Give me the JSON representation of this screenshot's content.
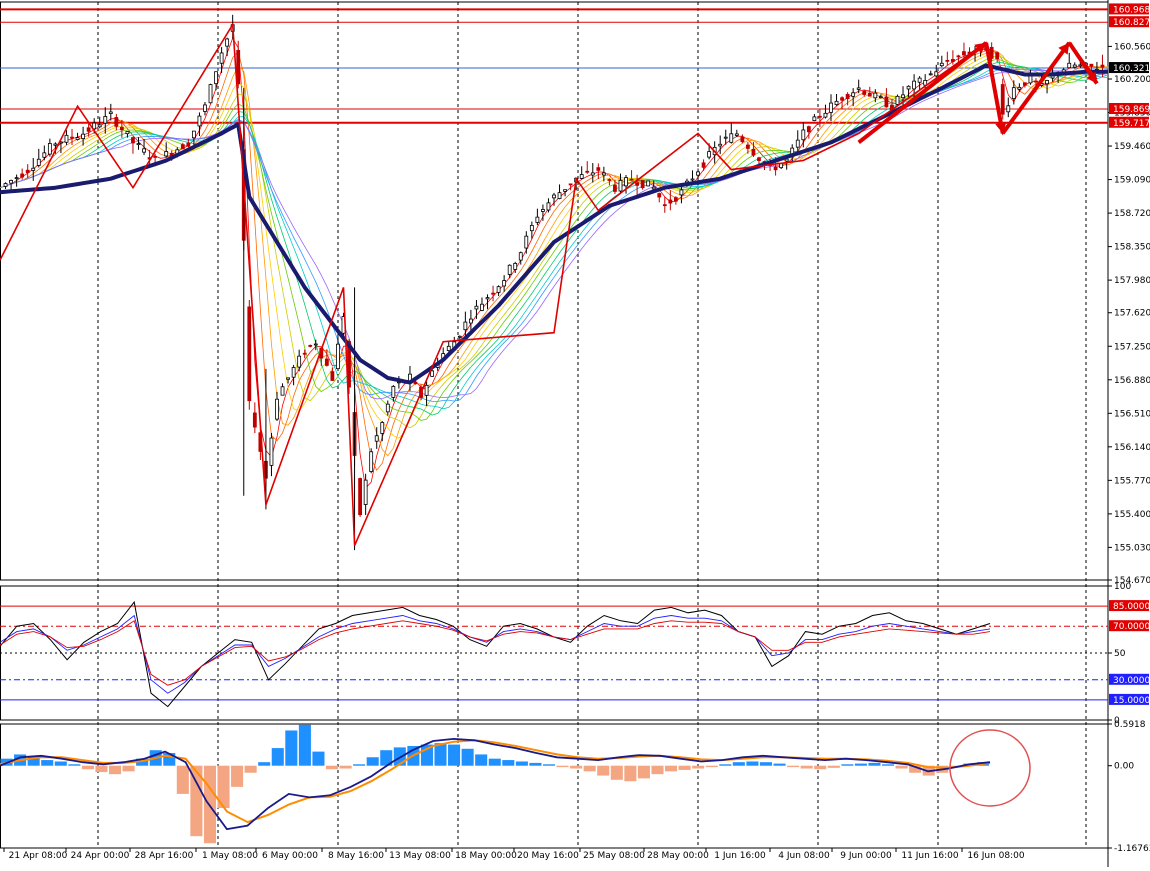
{
  "colors": {
    "background": "#ffffff",
    "bull": "#000000",
    "bear": "#c00000",
    "zigzag": "#e00000",
    "baseline_ma": "#1a1a6e",
    "level_red": "#e00000",
    "current_line": "#3366cc",
    "rsi_black": "#000000",
    "rsi_blue": "#1f1fff",
    "rsi_red": "#e00000",
    "macd_pos": "#1e90ff",
    "macd_neg": "#f4a582",
    "macd_line": "#1a1a8a",
    "signal_line": "#ff8c00",
    "ribbon": [
      "#ff0000",
      "#ff6600",
      "#ff9900",
      "#ffcc00",
      "#cccc00",
      "#66cc00",
      "#00cc66",
      "#00cccc",
      "#3399ff",
      "#9966ff"
    ]
  },
  "chart_data": [
    {
      "type": "candlestick",
      "title": "",
      "ylim": [
        154.67,
        161.05
      ],
      "y_ticks": [
        "160.560",
        "160.200",
        "159.830",
        "159.460",
        "159.090",
        "158.720",
        "158.350",
        "157.980",
        "157.620",
        "157.250",
        "156.880",
        "156.510",
        "156.140",
        "155.770",
        "155.400",
        "155.030",
        "154.670"
      ],
      "x_ticks": [
        "21 Apr 08:00",
        "24 Apr 00:00",
        "28 Apr 16:00",
        "1 May 08:00",
        "6 May 00:00",
        "8 May 16:00",
        "13 May 08:00",
        "18 May 00:00",
        "20 May 16:00",
        "25 May 08:00",
        "28 May 00:00",
        "1 Jun 16:00",
        "4 Jun 08:00",
        "9 Jun 00:00",
        "11 Jun 16:00",
        "16 Jun 08:00"
      ],
      "levels": [
        {
          "label": "160.968",
          "value": 160.968
        },
        {
          "label": "160.827",
          "value": 160.827
        },
        {
          "label": "159.869",
          "value": 159.869
        },
        {
          "label": "159.717",
          "value": 159.717
        }
      ],
      "current_price": {
        "label": "160.321",
        "value": 160.321
      },
      "close_path": [
        [
          0,
          159.0
        ],
        [
          5,
          159.2
        ],
        [
          10,
          159.5
        ],
        [
          15,
          159.6
        ],
        [
          20,
          159.8
        ],
        [
          24,
          159.5
        ],
        [
          28,
          159.3
        ],
        [
          31,
          159.4
        ],
        [
          34,
          159.5
        ],
        [
          37,
          159.9
        ],
        [
          40,
          160.5
        ],
        [
          42,
          160.8
        ],
        [
          43,
          160.1
        ],
        [
          44,
          158.4
        ],
        [
          45,
          156.6
        ],
        [
          46,
          156.4
        ],
        [
          48,
          155.8
        ],
        [
          50,
          156.7
        ],
        [
          52,
          156.9
        ],
        [
          55,
          157.2
        ],
        [
          57,
          157.3
        ],
        [
          60,
          156.9
        ],
        [
          62,
          157.6
        ],
        [
          64,
          156.0
        ],
        [
          65,
          155.4
        ],
        [
          67,
          156.1
        ],
        [
          69,
          156.4
        ],
        [
          71,
          156.8
        ],
        [
          74,
          156.9
        ],
        [
          76,
          156.7
        ],
        [
          79,
          157.1
        ],
        [
          82,
          157.3
        ],
        [
          85,
          157.6
        ],
        [
          88,
          157.8
        ],
        [
          91,
          158.0
        ],
        [
          94,
          158.3
        ],
        [
          97,
          158.7
        ],
        [
          100,
          158.9
        ],
        [
          104,
          159.1
        ],
        [
          108,
          159.2
        ],
        [
          111,
          159.0
        ],
        [
          114,
          159.1
        ],
        [
          118,
          159.0
        ],
        [
          120,
          158.8
        ],
        [
          123,
          158.95
        ],
        [
          126,
          159.2
        ],
        [
          130,
          159.5
        ],
        [
          133,
          159.6
        ],
        [
          136,
          159.4
        ],
        [
          139,
          159.2
        ],
        [
          142,
          159.3
        ],
        [
          145,
          159.6
        ],
        [
          148,
          159.8
        ],
        [
          152,
          160.0
        ],
        [
          155,
          160.1
        ],
        [
          158,
          160.0
        ],
        [
          161,
          159.9
        ],
        [
          164,
          160.1
        ],
        [
          167,
          160.2
        ],
        [
          171,
          160.4
        ],
        [
          175,
          160.5
        ],
        [
          178,
          160.55
        ],
        [
          180,
          160.4
        ],
        [
          181,
          159.8
        ],
        [
          183,
          160.1
        ],
        [
          186,
          160.2
        ],
        [
          188,
          160.1
        ],
        [
          191,
          160.3
        ],
        [
          194,
          160.35
        ],
        [
          196,
          160.33
        ]
      ],
      "baseline_path": [
        [
          0,
          158.95
        ],
        [
          10,
          159.0
        ],
        [
          20,
          159.1
        ],
        [
          30,
          159.3
        ],
        [
          40,
          159.6
        ],
        [
          43,
          159.7
        ],
        [
          45,
          158.9
        ],
        [
          50,
          158.4
        ],
        [
          55,
          157.9
        ],
        [
          60,
          157.5
        ],
        [
          65,
          157.1
        ],
        [
          70,
          156.9
        ],
        [
          74,
          156.85
        ],
        [
          80,
          157.1
        ],
        [
          90,
          157.7
        ],
        [
          100,
          158.4
        ],
        [
          110,
          158.8
        ],
        [
          120,
          159.0
        ],
        [
          130,
          159.1
        ],
        [
          140,
          159.3
        ],
        [
          150,
          159.5
        ],
        [
          160,
          159.8
        ],
        [
          170,
          160.1
        ],
        [
          178,
          160.35
        ],
        [
          185,
          160.25
        ],
        [
          190,
          160.25
        ],
        [
          196,
          160.28
        ]
      ],
      "zigzag": [
        [
          0,
          158.2
        ],
        [
          14,
          159.9
        ],
        [
          24,
          159.0
        ],
        [
          42,
          160.8
        ],
        [
          48,
          155.5
        ],
        [
          62,
          157.9
        ],
        [
          64,
          155.05
        ],
        [
          80,
          157.3
        ],
        [
          100,
          157.4
        ],
        [
          104,
          159.1
        ],
        [
          108,
          158.75
        ],
        [
          126,
          159.6
        ],
        [
          132,
          159.2
        ],
        [
          145,
          159.3
        ],
        [
          155,
          159.6
        ],
        [
          178,
          160.6
        ],
        [
          181,
          159.6
        ],
        [
          193,
          160.6
        ],
        [
          198,
          160.2
        ]
      ],
      "arrows": [
        {
          "from": [
            155,
            159.5
          ],
          "to": [
            178,
            160.6
          ]
        },
        {
          "from": [
            178,
            160.6
          ],
          "to": [
            181,
            159.6
          ]
        },
        {
          "from": [
            181,
            159.6
          ],
          "to": [
            193,
            160.6
          ]
        },
        {
          "from": [
            193,
            160.6
          ],
          "to": [
            198,
            160.15
          ]
        }
      ],
      "n_bars": 200
    },
    {
      "type": "line",
      "title": "",
      "ylim": [
        0,
        100
      ],
      "y_ticks": [
        "100",
        "50",
        "0"
      ],
      "levels": [
        {
          "label": "85.0000",
          "value": 85
        },
        {
          "label": "70.0000",
          "value": 70
        },
        {
          "label": "30.0000",
          "value": 30
        },
        {
          "label": "15.0000",
          "value": 15
        }
      ],
      "series": [
        {
          "values": [
            55,
            70,
            72,
            60,
            45,
            58,
            66,
            72,
            88,
            20,
            10,
            25,
            40,
            50,
            60,
            58,
            30,
            42,
            55,
            68,
            72,
            78,
            80,
            82,
            84,
            78,
            75,
            70,
            60,
            55,
            70,
            72,
            68,
            62,
            58,
            70,
            78,
            74,
            72,
            82,
            84,
            80,
            82,
            78,
            66,
            62,
            40,
            48,
            66,
            64,
            70,
            72,
            78,
            80,
            74,
            72,
            68,
            64,
            68,
            72
          ]
        },
        {
          "values": [
            58,
            66,
            68,
            62,
            52,
            56,
            62,
            68,
            78,
            30,
            20,
            28,
            40,
            48,
            56,
            56,
            40,
            46,
            54,
            62,
            68,
            72,
            74,
            76,
            78,
            74,
            72,
            68,
            62,
            58,
            66,
            68,
            66,
            62,
            60,
            66,
            72,
            70,
            70,
            76,
            78,
            76,
            76,
            74,
            66,
            62,
            48,
            50,
            60,
            60,
            64,
            66,
            70,
            72,
            70,
            68,
            66,
            64,
            66,
            68
          ]
        },
        {
          "values": [
            56,
            64,
            66,
            62,
            54,
            55,
            60,
            66,
            74,
            34,
            26,
            30,
            40,
            47,
            54,
            55,
            44,
            47,
            53,
            60,
            65,
            68,
            70,
            72,
            74,
            72,
            70,
            67,
            62,
            59,
            64,
            66,
            65,
            62,
            60,
            64,
            68,
            68,
            68,
            72,
            74,
            73,
            73,
            72,
            66,
            62,
            52,
            52,
            58,
            58,
            62,
            64,
            66,
            68,
            67,
            66,
            65,
            64,
            64,
            66
          ]
        }
      ]
    },
    {
      "type": "bar",
      "title": "",
      "ylim": [
        -1.16763,
        0.5918
      ],
      "y_ticks": [
        "0.5918",
        "0.00",
        "-1.16763"
      ],
      "histogram": [
        0.1,
        0.16,
        0.12,
        0.08,
        0.06,
        0.02,
        -0.05,
        -0.09,
        -0.12,
        -0.08,
        0.1,
        0.22,
        0.18,
        -0.4,
        -1.0,
        -1.1,
        -0.6,
        -0.3,
        -0.1,
        0.05,
        0.25,
        0.5,
        0.58,
        0.2,
        -0.05,
        -0.04,
        0.02,
        0.12,
        0.22,
        0.26,
        0.28,
        0.3,
        0.32,
        0.3,
        0.24,
        0.16,
        0.1,
        0.08,
        0.06,
        0.04,
        0.02,
        -0.02,
        -0.04,
        -0.08,
        -0.14,
        -0.2,
        -0.22,
        -0.18,
        -0.12,
        -0.08,
        -0.06,
        -0.04,
        -0.02,
        0.02,
        0.05,
        0.06,
        0.05,
        0.03,
        -0.02,
        -0.04,
        -0.05,
        -0.03,
        0.02,
        0.03,
        0.04,
        0.02,
        -0.04,
        -0.1,
        -0.14,
        -0.1,
        -0.02,
        0.03,
        0.05
      ],
      "macd": [
        0.0,
        0.12,
        0.14,
        0.1,
        0.05,
        0.02,
        0.05,
        0.1,
        0.2,
        0.05,
        -0.5,
        -0.9,
        -0.85,
        -0.6,
        -0.4,
        -0.45,
        -0.42,
        -0.3,
        -0.15,
        0.05,
        0.22,
        0.35,
        0.38,
        0.36,
        0.3,
        0.25,
        0.18,
        0.12,
        0.1,
        0.08,
        0.12,
        0.15,
        0.14,
        0.1,
        0.06,
        0.08,
        0.12,
        0.14,
        0.12,
        0.1,
        0.08,
        0.1,
        0.08,
        0.05,
        0.02,
        -0.08,
        -0.04,
        0.02,
        0.05
      ],
      "signal": [
        0.02,
        0.08,
        0.12,
        0.12,
        0.08,
        0.04,
        0.04,
        0.07,
        0.14,
        0.1,
        -0.25,
        -0.65,
        -0.8,
        -0.7,
        -0.55,
        -0.45,
        -0.44,
        -0.36,
        -0.22,
        -0.05,
        0.14,
        0.28,
        0.34,
        0.36,
        0.33,
        0.28,
        0.22,
        0.16,
        0.12,
        0.1,
        0.11,
        0.13,
        0.14,
        0.12,
        0.09,
        0.08,
        0.1,
        0.12,
        0.12,
        0.11,
        0.1,
        0.1,
        0.09,
        0.07,
        0.04,
        -0.02,
        -0.03,
        0.0,
        0.04
      ]
    }
  ]
}
